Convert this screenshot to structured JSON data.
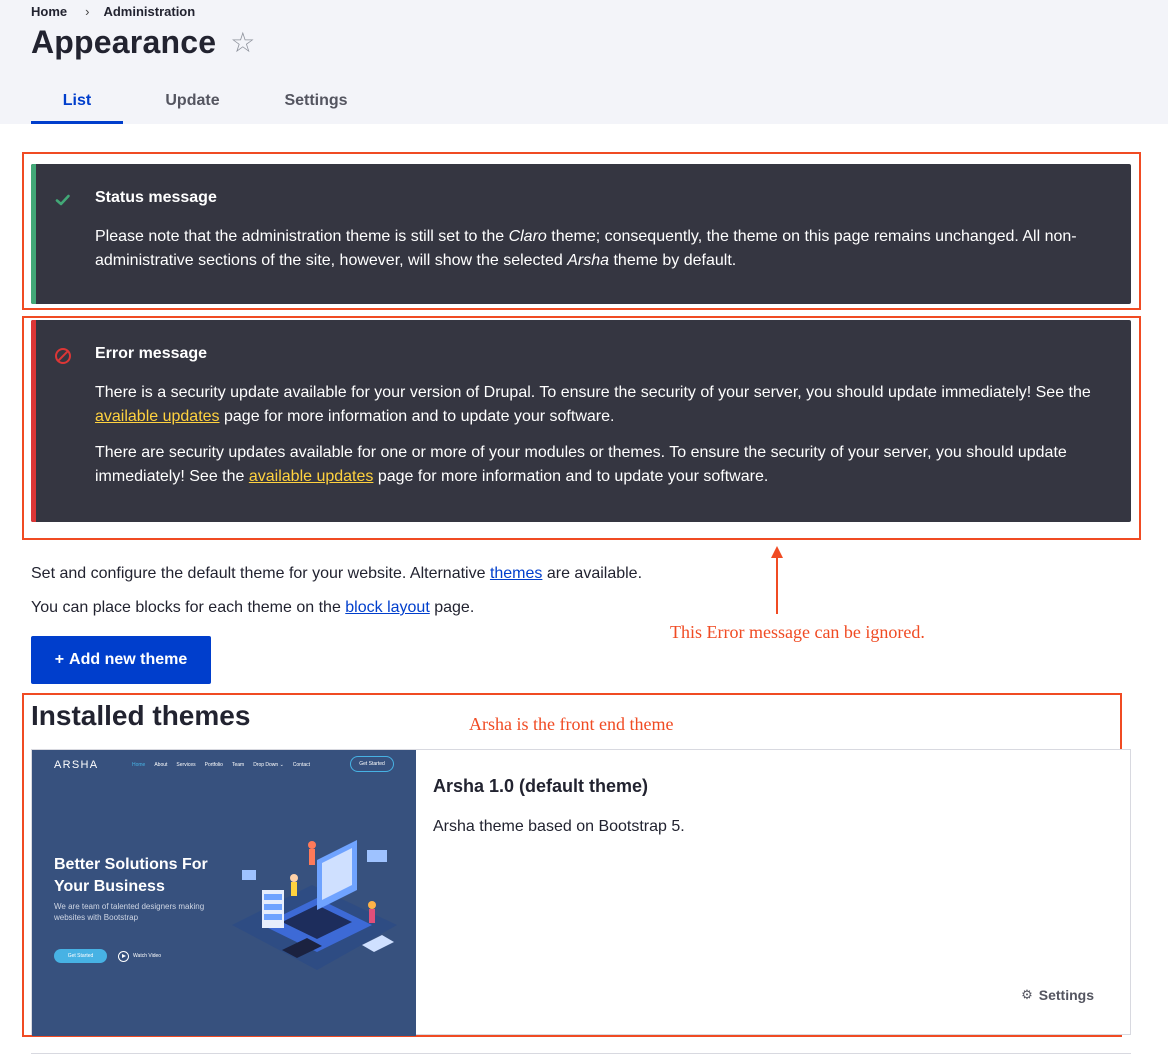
{
  "breadcrumb": {
    "home": "Home",
    "separator": "›",
    "current": "Administration"
  },
  "page": {
    "title": "Appearance",
    "favorite_icon": "☆"
  },
  "tabs": [
    {
      "label": "List",
      "active": true
    },
    {
      "label": "Update",
      "active": false
    },
    {
      "label": "Settings",
      "active": false
    }
  ],
  "status_message": {
    "title": "Status message",
    "icon": "✔",
    "text_1": "Please note that the administration theme is still set to the ",
    "theme_admin": "Claro",
    "text_2": " theme; consequently, the theme on this page remains unchanged. All non-administrative sections of the site, however, will show the selected ",
    "theme_default": "Arsha",
    "text_3": " theme by default.",
    "accent_color": "#42a877"
  },
  "error_message": {
    "title": "Error message",
    "icon": "⊘",
    "accent_color": "#dc3636",
    "paragraph_1": {
      "before": "There is a security update available for your version of Drupal. To ensure the security of your server, you should update immediately! See the ",
      "link": "available updates",
      "after": " page for more information and to update your software."
    },
    "paragraph_2": {
      "before": "There are security updates available for one or more of your modules or themes. To ensure the security of your server, you should update immediately! See the ",
      "link": "available updates",
      "after": " page for more information and to update your software."
    }
  },
  "annotations": {
    "error_note": "This Error message can be ignored.",
    "theme_note": "Arsha is the front end theme",
    "color": "#f04b23"
  },
  "intro": {
    "line1_before": "Set and configure the default theme for your website. Alternative ",
    "line1_link": "themes",
    "line1_after": " are available.",
    "line2_before": "You can place blocks for each theme on the ",
    "line2_link": "block layout",
    "line2_after": " page."
  },
  "add_theme_button": {
    "plus": "+",
    "label": "Add new theme"
  },
  "installed": {
    "heading": "Installed themes",
    "themes": [
      {
        "name": "Arsha 1.0 (default theme)",
        "description": "Arsha theme based on Bootstrap 5.",
        "settings_label": "Settings",
        "screenshot": {
          "logo": "ARSHA",
          "nav": [
            "Home",
            "About",
            "Services",
            "Portfolio",
            "Team",
            "Drop Down ⌄",
            "Contact"
          ],
          "nav_button": "Get Started",
          "headline_1": "Better Solutions For",
          "headline_2": "Your Business",
          "subtext": "We are team of talented designers making websites with Bootstrap",
          "cta": "Get Started",
          "watch": "Watch Video",
          "bg_color": "#37517e",
          "accent_color": "#47b2e4"
        }
      }
    ]
  }
}
